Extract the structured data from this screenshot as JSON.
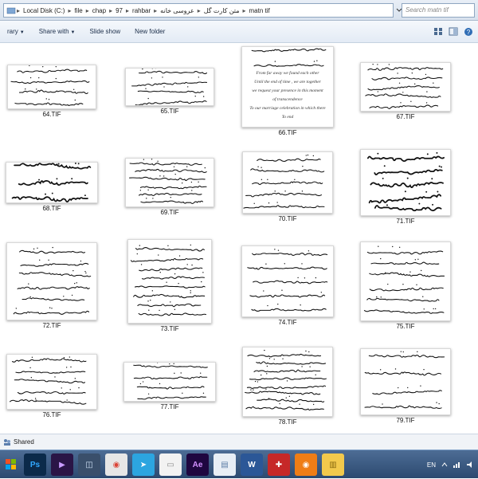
{
  "address_bar": {
    "crumbs": [
      "Local Disk (C:)",
      "file",
      "chap",
      "97",
      "rahbar",
      "عروسی خانه",
      "متن کارت گل",
      "matn tif"
    ],
    "search_placeholder": "Search matn tif"
  },
  "toolbar": {
    "items": [
      "rary",
      "Share with",
      "Slide show",
      "New folder"
    ]
  },
  "files": [
    {
      "name": "64.TIF"
    },
    {
      "name": "65.TIF"
    },
    {
      "name": "66.TIF"
    },
    {
      "name": "67.TIF"
    },
    {
      "name": "68.TIF"
    },
    {
      "name": "69.TIF"
    },
    {
      "name": "70.TIF"
    },
    {
      "name": "71.TIF"
    },
    {
      "name": "72.TIF"
    },
    {
      "name": "73.TIF"
    },
    {
      "name": "74.TIF"
    },
    {
      "name": "75.TIF"
    },
    {
      "name": "76.TIF"
    },
    {
      "name": "77.TIF"
    },
    {
      "name": "78.TIF"
    },
    {
      "name": "79.TIF"
    }
  ],
  "thumb_66_text": [
    "From far away we found each other",
    "Until the end of time , we are together",
    "we request your presence in this moment",
    "of transcendence",
    "To our marriage celebration in which there",
    "To end"
  ],
  "status": {
    "label": "Shared"
  },
  "taskbar": {
    "apps": [
      {
        "name": "photoshop",
        "label": "Ps",
        "bg": "#0b2a4a",
        "fg": "#31a8ff"
      },
      {
        "name": "premiere",
        "label": "▶",
        "bg": "#2a1546",
        "fg": "#c99cff"
      },
      {
        "name": "app3",
        "label": "◫",
        "bg": "#3a4f6b",
        "fg": "#cfe0f5"
      },
      {
        "name": "chrome",
        "label": "◉",
        "bg": "#e6e6e6",
        "fg": "#db4437"
      },
      {
        "name": "telegram",
        "label": "➤",
        "bg": "#2ca5e0",
        "fg": "#ffffff"
      },
      {
        "name": "file",
        "label": "▭",
        "bg": "#f2f2f2",
        "fg": "#888888"
      },
      {
        "name": "after-effects",
        "label": "Ae",
        "bg": "#1f0740",
        "fg": "#d291ff"
      },
      {
        "name": "explorer",
        "label": "▤",
        "bg": "#e8eef5",
        "fg": "#5b7da5"
      },
      {
        "name": "word",
        "label": "W",
        "bg": "#2b5797",
        "fg": "#ffffff"
      },
      {
        "name": "app10",
        "label": "✚",
        "bg": "#c62828",
        "fg": "#ffffff"
      },
      {
        "name": "app11",
        "label": "◉",
        "bg": "#ef7d16",
        "fg": "#ffffff"
      },
      {
        "name": "folder",
        "label": "▥",
        "bg": "#f2c94c",
        "fg": "#8a6a10"
      }
    ],
    "language": "EN"
  }
}
